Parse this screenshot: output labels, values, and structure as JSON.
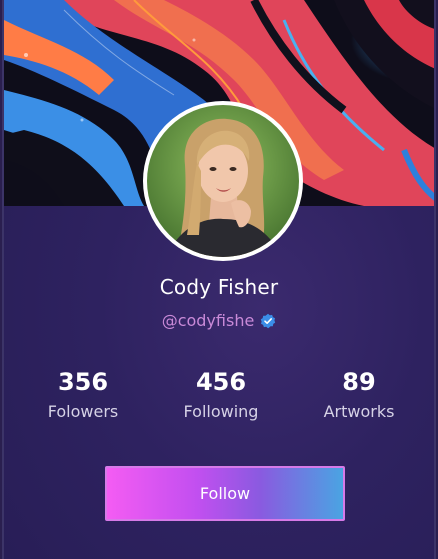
{
  "profile": {
    "name": "Cody Fisher",
    "handle": "@codyfishe",
    "verified_icon": "verified-badge-icon",
    "avatar_icon": "profile-photo"
  },
  "stats": [
    {
      "value": "356",
      "label": "Folowers"
    },
    {
      "value": "456",
      "label": "Following"
    },
    {
      "value": "89",
      "label": "Artworks"
    }
  ],
  "actions": {
    "follow_label": "Follow"
  },
  "colors": {
    "card_background": "#2e2260",
    "handle_text": "#c98ad8",
    "verified_badge": "#3b8ee8",
    "button_gradient_start": "#f45cf3",
    "button_gradient_end": "#4aa4e2",
    "button_border": "#d67ae8"
  }
}
